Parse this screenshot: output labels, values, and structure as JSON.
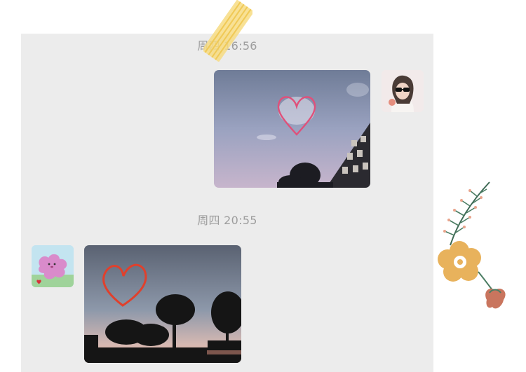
{
  "chat": {
    "messages": [
      {
        "timestamp": "周四 16:56",
        "sender": "self",
        "type": "image"
      },
      {
        "timestamp": "周四 20:55",
        "sender": "other",
        "type": "image"
      }
    ]
  },
  "colors": {
    "panel": "#ececec",
    "timestamp": "#9d9d9d",
    "heart_pink": "#e0507a",
    "heart_red": "#e0402c",
    "tape": "#f7dc82"
  },
  "icons": {
    "self_avatar": "girl-sunglasses-avatar",
    "other_avatar": "pink-blob-avatar",
    "decor": [
      "washi-tape",
      "flower-fern-sticker"
    ]
  }
}
